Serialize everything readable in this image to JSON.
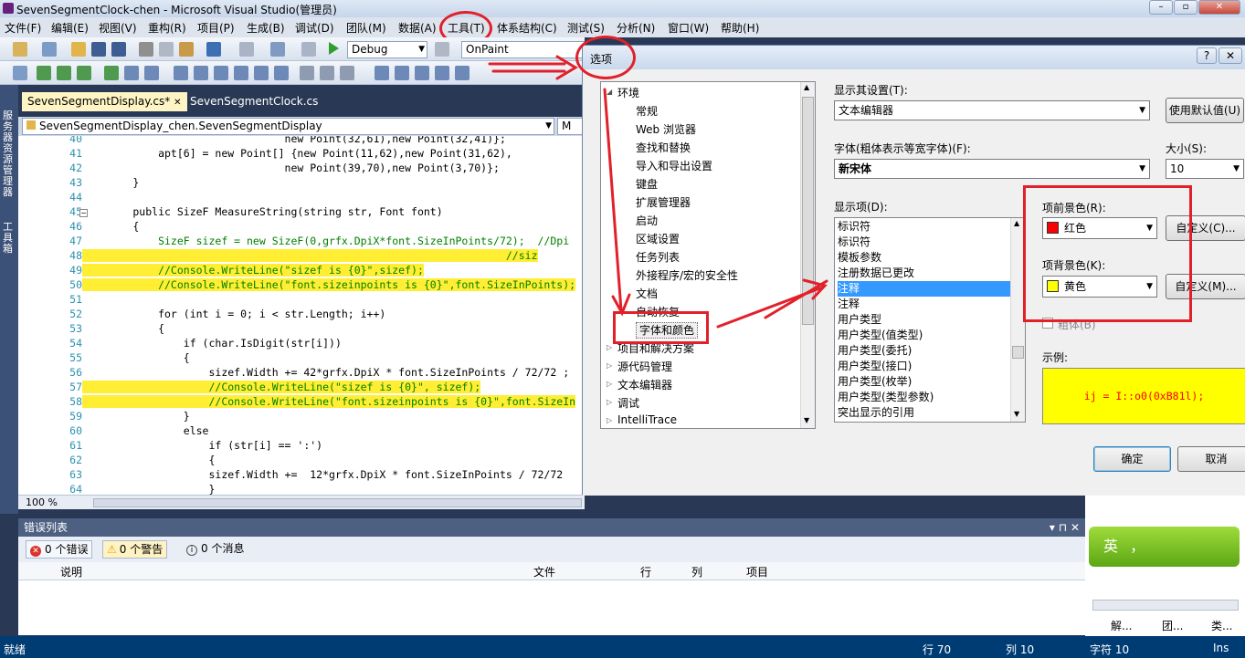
{
  "window": {
    "title": "SevenSegmentClock-chen - Microsoft Visual Studio(管理员)",
    "min": "–",
    "max": "▫",
    "close": "✕"
  },
  "menu": [
    "文件(F)",
    "编辑(E)",
    "视图(V)",
    "重构(R)",
    "项目(P)",
    "生成(B)",
    "调试(D)",
    "团队(M)",
    "数据(A)",
    "工具(T)",
    "体系结构(C)",
    "测试(S)",
    "分析(N)",
    "窗口(W)",
    "帮助(H)"
  ],
  "toolbar": {
    "config": "Debug",
    "find": "OnPaint"
  },
  "sidebar": {
    "server_explorer": "服务器资源管理器",
    "toolbox": "工具箱"
  },
  "tabs": [
    "SevenSegmentDisplay.cs*",
    "SevenSegmentClock.cs"
  ],
  "nav": {
    "class_combo": "SevenSegmentDisplay_chen.SevenSegmentDisplay",
    "member_combo": "M"
  },
  "editor": {
    "zoom": "100 %",
    "lines": [
      {
        "n": "40",
        "t": "                                new Point(32,61),new Point(32,41)};"
      },
      {
        "n": "41",
        "t": "            apt[6] = new Point[] {new Point(11,62),new Point(31,62),"
      },
      {
        "n": "42",
        "t": "                                new Point(39,70),new Point(3,70)};"
      },
      {
        "n": "43",
        "t": "        }"
      },
      {
        "n": "44",
        "t": ""
      },
      {
        "n": "45",
        "t": "        public SizeF MeasureString(string str, Font font)"
      },
      {
        "n": "46",
        "t": "        {"
      },
      {
        "n": "47",
        "t": "            SizeF sizef = new SizeF(0,grfx.DpiX*font.SizeInPoints/72);  //Dpi"
      },
      {
        "n": "48",
        "t": "                                                                   //siz"
      },
      {
        "n": "49",
        "t": "            //Console.WriteLine(\"sizef is {0}\",sizef);"
      },
      {
        "n": "50",
        "t": "            //Console.WriteLine(\"font.sizeinpoints is {0}\",font.SizeInPoints);"
      },
      {
        "n": "51",
        "t": ""
      },
      {
        "n": "52",
        "t": "            for (int i = 0; i < str.Length; i++)"
      },
      {
        "n": "53",
        "t": "            {"
      },
      {
        "n": "54",
        "t": "                if (char.IsDigit(str[i]))"
      },
      {
        "n": "55",
        "t": "                {"
      },
      {
        "n": "56",
        "t": "                    sizef.Width += 42*grfx.DpiX * font.SizeInPoints / 72/72 ;"
      },
      {
        "n": "57",
        "t": "                    //Console.WriteLine(\"sizef is {0}\", sizef);"
      },
      {
        "n": "58",
        "t": "                    //Console.WriteLine(\"font.sizeinpoints is {0}\",font.SizeIn"
      },
      {
        "n": "59",
        "t": "                }"
      },
      {
        "n": "60",
        "t": "                else"
      },
      {
        "n": "61",
        "t": "                    if (str[i] == ':')"
      },
      {
        "n": "62",
        "t": "                    {"
      },
      {
        "n": "63",
        "t": "                    sizef.Width +=  12*grfx.DpiX * font.SizeInPoints / 72/72"
      },
      {
        "n": "64",
        "t": "                    }"
      }
    ]
  },
  "error_list": {
    "title": "错误列表",
    "errors": "0 个错误",
    "warnings": "0 个警告",
    "messages": "0 个消息",
    "columns": [
      "说明",
      "文件",
      "行",
      "列",
      "项目"
    ],
    "pin": "▾ ⊓ ✕"
  },
  "status": {
    "left": "就绪",
    "row": "行 70",
    "col": "列 10",
    "ch": "字符 10",
    "mode": "Ins"
  },
  "right_panel": {
    "ime_char": "英",
    "ime_punct": "，",
    "tab1": "解...",
    "tab2": "团...",
    "tab3": "类..."
  },
  "dialog": {
    "title": "选项",
    "help": "?",
    "close": "✕",
    "tree": [
      {
        "label": "环境",
        "indent": 0,
        "expanded": true
      },
      {
        "label": "常规",
        "indent": 1
      },
      {
        "label": "Web 浏览器",
        "indent": 1
      },
      {
        "label": "查找和替换",
        "indent": 1
      },
      {
        "label": "导入和导出设置",
        "indent": 1
      },
      {
        "label": "键盘",
        "indent": 1
      },
      {
        "label": "扩展管理器",
        "indent": 1
      },
      {
        "label": "启动",
        "indent": 1
      },
      {
        "label": "区域设置",
        "indent": 1
      },
      {
        "label": "任务列表",
        "indent": 1
      },
      {
        "label": "外接程序/宏的安全性",
        "indent": 1
      },
      {
        "label": "文档",
        "indent": 1
      },
      {
        "label": "自动恢复",
        "indent": 1
      },
      {
        "label": "字体和颜色",
        "indent": 1,
        "selected": true
      },
      {
        "label": "项目和解决方案",
        "indent": 0
      },
      {
        "label": "源代码管理",
        "indent": 0
      },
      {
        "label": "文本编辑器",
        "indent": 0
      },
      {
        "label": "调试",
        "indent": 0
      },
      {
        "label": "IntelliTrace",
        "indent": 0
      }
    ],
    "show_settings_for_label": "显示其设置(T):",
    "show_settings_for": "文本编辑器",
    "use_defaults": "使用默认值(U)",
    "font_label": "字体(粗体表示等宽字体)(F):",
    "font": "新宋体",
    "size_label": "大小(S):",
    "size": "10",
    "display_items_label": "显示项(D):",
    "display_items": [
      "标识符",
      "标识符",
      "模板参数",
      "注册数据已更改",
      "注释",
      "注释",
      "用户类型",
      "用户类型(值类型)",
      "用户类型(委托)",
      "用户类型(接口)",
      "用户类型(枚举)",
      "用户类型(类型参数)",
      "突出显示的引用"
    ],
    "selected_item_index": 4,
    "fg_label": "项前景色(R):",
    "fg_value": "红色",
    "fg_color": "#ff0000",
    "bg_label": "项背景色(K):",
    "bg_value": "黄色",
    "bg_color": "#ffff00",
    "custom_fg": "自定义(C)...",
    "custom_bg": "自定义(M)...",
    "bold_label": "粗体(B)",
    "sample_label": "示例:",
    "sample_text": "ij = I::o0(0xB81l);",
    "ok": "确定",
    "cancel": "取消"
  }
}
